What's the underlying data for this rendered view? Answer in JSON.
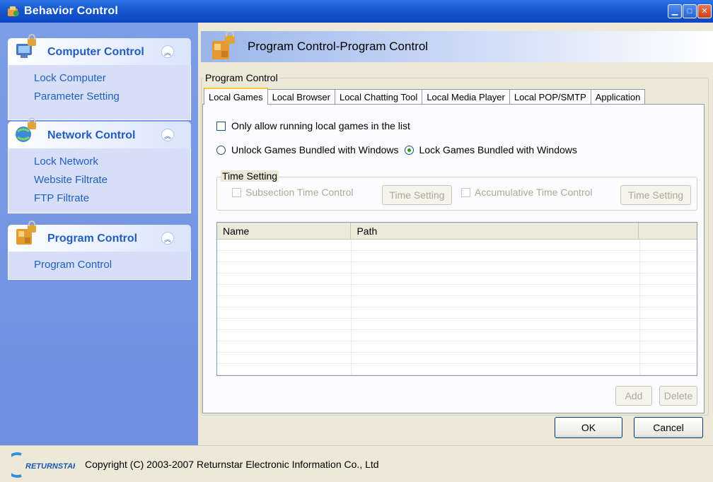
{
  "window": {
    "title": "Behavior Control"
  },
  "sidebar": {
    "groups": [
      {
        "title": "Computer Control",
        "items": [
          "Lock Computer",
          "Parameter Setting"
        ]
      },
      {
        "title": "Network Control",
        "items": [
          "Lock Network",
          "Website Filtrate",
          "FTP Filtrate"
        ]
      },
      {
        "title": "Program Control",
        "items": [
          "Program Control"
        ]
      }
    ]
  },
  "main": {
    "header_title": "Program Control-Program Control",
    "group_label": "Program Control",
    "tabs": [
      "Local Games",
      "Local Browser",
      "Local Chatting Tool",
      "Local Media Player",
      "Local POP/SMTP",
      "Application"
    ],
    "only_allow_label": "Only allow running local games in the list",
    "radio_unlock_label": "Unlock Games Bundled with Windows",
    "radio_lock_label": "Lock Games Bundled with Windows",
    "time_setting": {
      "legend": "Time Setting",
      "subsection_label": "Subsection Time Control",
      "accumulative_label": "Accumulative Time Control",
      "button_label": "Time Setting"
    },
    "table": {
      "columns": [
        "Name",
        "Path",
        ""
      ]
    },
    "add_label": "Add",
    "delete_label": "Delete",
    "ok_label": "OK",
    "cancel_label": "Cancel"
  },
  "footer": {
    "logo_text": "RETURNSTAR",
    "copyright": "Copyright (C) 2003-2007 Returnstar Electronic Information Co., Ltd"
  },
  "colors": {
    "titlebar": "#1959d0",
    "sidebar": "#7b9ee6",
    "link": "#215dc6",
    "panel": "#ece9d8"
  },
  "icons": [
    "app-icon",
    "computer-lock-icon",
    "network-lock-icon",
    "program-lock-icon",
    "collapse-icon"
  ]
}
